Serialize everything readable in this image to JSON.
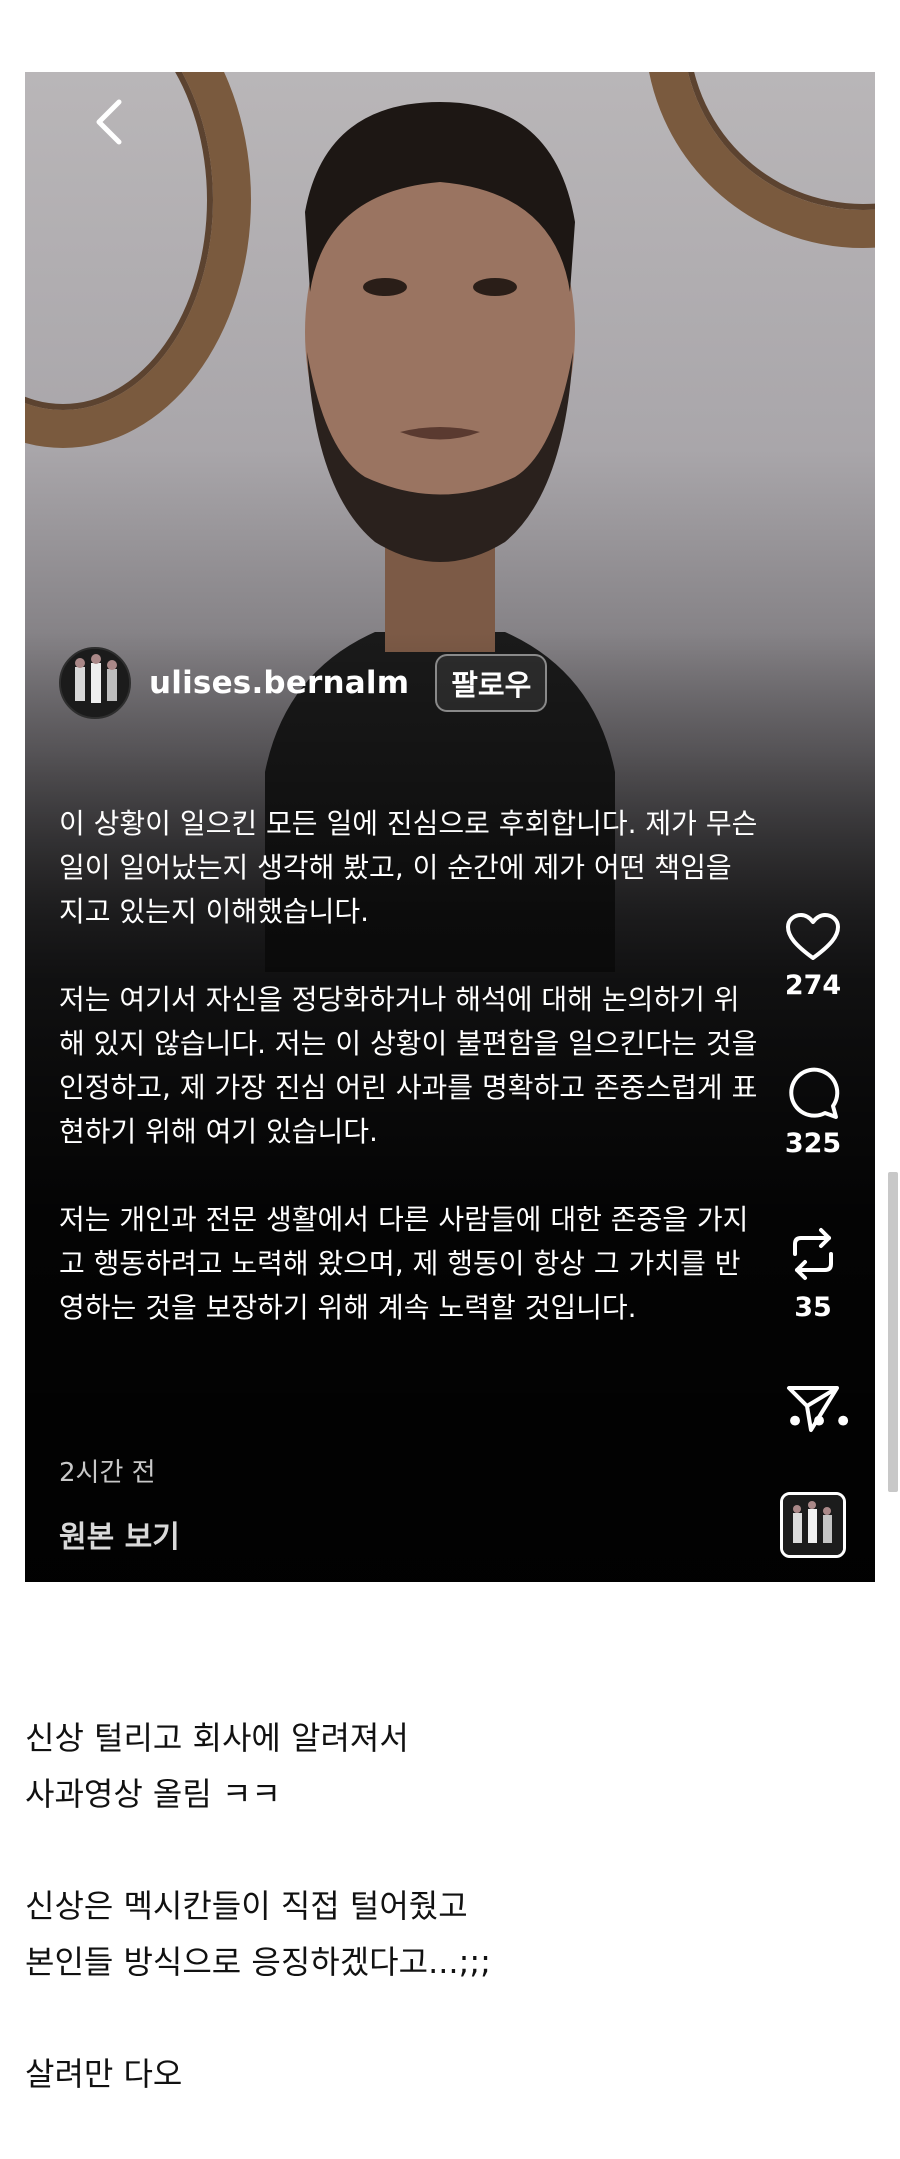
{
  "reel": {
    "username": "ulises.bernalm",
    "follow_label": "팔로우",
    "caption": [
      "이 상황이 일으킨 모든 일에 진심으로 후회합니다. 제가 무슨 일이 일어났는지 생각해 봤고, 이 순간에 제가 어떤 책임을 지고 있는지 이해했습니다.",
      "저는 여기서 자신을 정당화하거나 해석에 대해 논의하기 위해 있지 않습니다. 저는 이 상황이 불편함을 일으킨다는 것을 인정하고, 제 가장 진심 어린 사과를 명확하고 존중스럽게 표현하기 위해 여기 있습니다.",
      "저는 개인과 전문 생활에서 다른 사람들에 대한 존중을 가지고 행동하려고 노력해 왔으며, 제 행동이 항상 그 가치를 반영하는 것을 보장하기 위해 계속 노력할 것입니다."
    ],
    "time_ago": "2시간 전",
    "view_original": "원본 보기",
    "actions": {
      "like_icon": "heart-icon",
      "like_count": "274",
      "comment_icon": "comment-icon",
      "comment_count": "325",
      "repost_icon": "repost-icon",
      "repost_count": "35",
      "share_icon": "send-icon",
      "more_label": "•••"
    }
  },
  "post_text": {
    "line1": "신상 털리고 회사에 알려져서",
    "line2": "사과영상 올림 ㅋㅋ",
    "line3": "신상은 멕시칸들이 직접 털어줬고",
    "line4": "본인들 방식으로 응징하겠다고...;;;",
    "line5": "살려만 다오"
  }
}
